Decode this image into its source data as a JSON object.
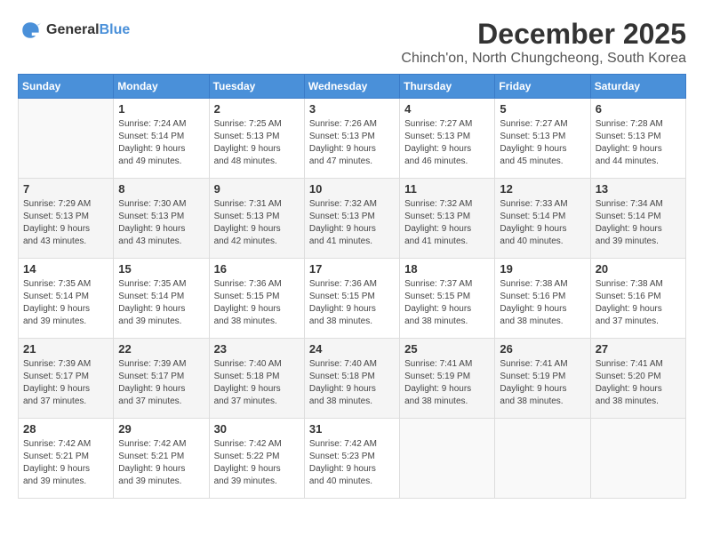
{
  "logo": {
    "general": "General",
    "blue": "Blue"
  },
  "header": {
    "month": "December 2025",
    "location": "Chinch'on, North Chungcheong, South Korea"
  },
  "weekdays": [
    "Sunday",
    "Monday",
    "Tuesday",
    "Wednesday",
    "Thursday",
    "Friday",
    "Saturday"
  ],
  "weeks": [
    [
      {
        "day": "",
        "info": ""
      },
      {
        "day": "1",
        "info": "Sunrise: 7:24 AM\nSunset: 5:14 PM\nDaylight: 9 hours\nand 49 minutes."
      },
      {
        "day": "2",
        "info": "Sunrise: 7:25 AM\nSunset: 5:13 PM\nDaylight: 9 hours\nand 48 minutes."
      },
      {
        "day": "3",
        "info": "Sunrise: 7:26 AM\nSunset: 5:13 PM\nDaylight: 9 hours\nand 47 minutes."
      },
      {
        "day": "4",
        "info": "Sunrise: 7:27 AM\nSunset: 5:13 PM\nDaylight: 9 hours\nand 46 minutes."
      },
      {
        "day": "5",
        "info": "Sunrise: 7:27 AM\nSunset: 5:13 PM\nDaylight: 9 hours\nand 45 minutes."
      },
      {
        "day": "6",
        "info": "Sunrise: 7:28 AM\nSunset: 5:13 PM\nDaylight: 9 hours\nand 44 minutes."
      }
    ],
    [
      {
        "day": "7",
        "info": "Sunrise: 7:29 AM\nSunset: 5:13 PM\nDaylight: 9 hours\nand 43 minutes."
      },
      {
        "day": "8",
        "info": "Sunrise: 7:30 AM\nSunset: 5:13 PM\nDaylight: 9 hours\nand 43 minutes."
      },
      {
        "day": "9",
        "info": "Sunrise: 7:31 AM\nSunset: 5:13 PM\nDaylight: 9 hours\nand 42 minutes."
      },
      {
        "day": "10",
        "info": "Sunrise: 7:32 AM\nSunset: 5:13 PM\nDaylight: 9 hours\nand 41 minutes."
      },
      {
        "day": "11",
        "info": "Sunrise: 7:32 AM\nSunset: 5:13 PM\nDaylight: 9 hours\nand 41 minutes."
      },
      {
        "day": "12",
        "info": "Sunrise: 7:33 AM\nSunset: 5:14 PM\nDaylight: 9 hours\nand 40 minutes."
      },
      {
        "day": "13",
        "info": "Sunrise: 7:34 AM\nSunset: 5:14 PM\nDaylight: 9 hours\nand 39 minutes."
      }
    ],
    [
      {
        "day": "14",
        "info": "Sunrise: 7:35 AM\nSunset: 5:14 PM\nDaylight: 9 hours\nand 39 minutes."
      },
      {
        "day": "15",
        "info": "Sunrise: 7:35 AM\nSunset: 5:14 PM\nDaylight: 9 hours\nand 39 minutes."
      },
      {
        "day": "16",
        "info": "Sunrise: 7:36 AM\nSunset: 5:15 PM\nDaylight: 9 hours\nand 38 minutes."
      },
      {
        "day": "17",
        "info": "Sunrise: 7:36 AM\nSunset: 5:15 PM\nDaylight: 9 hours\nand 38 minutes."
      },
      {
        "day": "18",
        "info": "Sunrise: 7:37 AM\nSunset: 5:15 PM\nDaylight: 9 hours\nand 38 minutes."
      },
      {
        "day": "19",
        "info": "Sunrise: 7:38 AM\nSunset: 5:16 PM\nDaylight: 9 hours\nand 38 minutes."
      },
      {
        "day": "20",
        "info": "Sunrise: 7:38 AM\nSunset: 5:16 PM\nDaylight: 9 hours\nand 37 minutes."
      }
    ],
    [
      {
        "day": "21",
        "info": "Sunrise: 7:39 AM\nSunset: 5:17 PM\nDaylight: 9 hours\nand 37 minutes."
      },
      {
        "day": "22",
        "info": "Sunrise: 7:39 AM\nSunset: 5:17 PM\nDaylight: 9 hours\nand 37 minutes."
      },
      {
        "day": "23",
        "info": "Sunrise: 7:40 AM\nSunset: 5:18 PM\nDaylight: 9 hours\nand 37 minutes."
      },
      {
        "day": "24",
        "info": "Sunrise: 7:40 AM\nSunset: 5:18 PM\nDaylight: 9 hours\nand 38 minutes."
      },
      {
        "day": "25",
        "info": "Sunrise: 7:41 AM\nSunset: 5:19 PM\nDaylight: 9 hours\nand 38 minutes."
      },
      {
        "day": "26",
        "info": "Sunrise: 7:41 AM\nSunset: 5:19 PM\nDaylight: 9 hours\nand 38 minutes."
      },
      {
        "day": "27",
        "info": "Sunrise: 7:41 AM\nSunset: 5:20 PM\nDaylight: 9 hours\nand 38 minutes."
      }
    ],
    [
      {
        "day": "28",
        "info": "Sunrise: 7:42 AM\nSunset: 5:21 PM\nDaylight: 9 hours\nand 39 minutes."
      },
      {
        "day": "29",
        "info": "Sunrise: 7:42 AM\nSunset: 5:21 PM\nDaylight: 9 hours\nand 39 minutes."
      },
      {
        "day": "30",
        "info": "Sunrise: 7:42 AM\nSunset: 5:22 PM\nDaylight: 9 hours\nand 39 minutes."
      },
      {
        "day": "31",
        "info": "Sunrise: 7:42 AM\nSunset: 5:23 PM\nDaylight: 9 hours\nand 40 minutes."
      },
      {
        "day": "",
        "info": ""
      },
      {
        "day": "",
        "info": ""
      },
      {
        "day": "",
        "info": ""
      }
    ]
  ]
}
